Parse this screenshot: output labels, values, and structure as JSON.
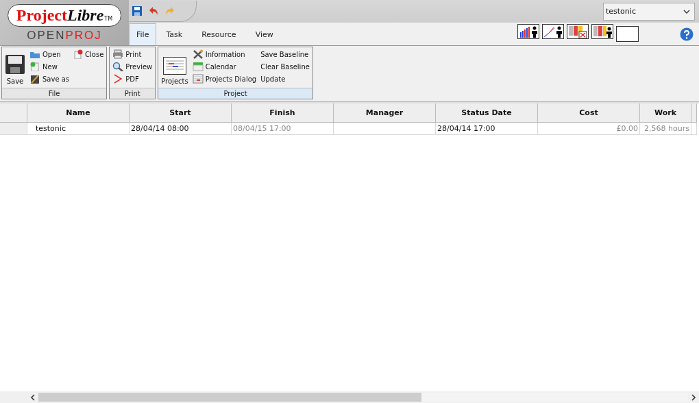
{
  "logo": {
    "name_a": "Project",
    "name_b": "Libre",
    "tm": "TM",
    "sub_a": "OPEN",
    "sub_b": "PROJ"
  },
  "project_select": {
    "value": "testonic"
  },
  "tabs": [
    {
      "label": "File",
      "selected": true
    },
    {
      "label": "Task",
      "selected": false
    },
    {
      "label": "Resource",
      "selected": false
    },
    {
      "label": "View",
      "selected": false
    }
  ],
  "ribbon": [
    {
      "title": "File",
      "selected": false,
      "big": "Save",
      "items": [
        "Open",
        "New",
        "Save as"
      ],
      "extra": [
        "Close"
      ]
    },
    {
      "title": "Print",
      "selected": false,
      "items": [
        "Print",
        "Preview",
        "PDF"
      ]
    },
    {
      "title": "Project",
      "selected": true,
      "big": "Projects",
      "items": [
        "Information",
        "Calendar",
        "Projects Dialog"
      ],
      "extra": [
        "Save Baseline",
        "Clear Baseline",
        "Update"
      ]
    }
  ],
  "table": {
    "columns": [
      "Name",
      "Start",
      "Finish",
      "Manager",
      "Status Date",
      "Cost",
      "Work"
    ],
    "rows": [
      {
        "cells": [
          {
            "text": "testonic",
            "muted": false
          },
          {
            "text": "28/04/14 08:00",
            "muted": false
          },
          {
            "text": "08/04/15 17:00",
            "muted": true
          },
          {
            "text": ""
          },
          {
            "text": "28/04/14 17:00",
            "muted": false
          },
          {
            "text": "£0.00",
            "muted": true
          },
          {
            "text": "2,568 hours",
            "muted": true
          }
        ]
      }
    ]
  }
}
